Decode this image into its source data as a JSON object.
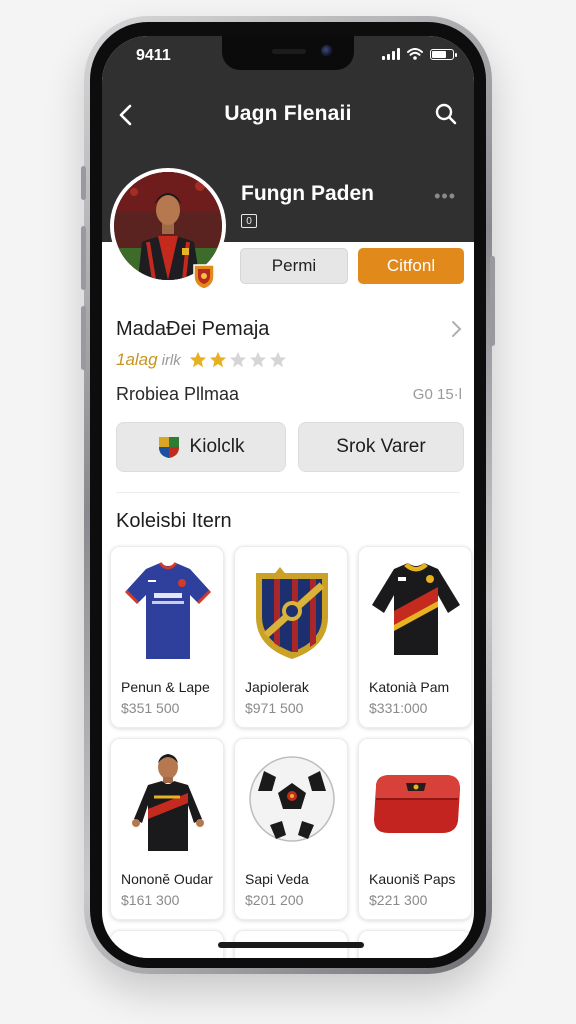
{
  "status_bar": {
    "time": "9411"
  },
  "nav": {
    "title": "Uagn Flenaii"
  },
  "profile": {
    "name": "Fungn Paden",
    "tag": "0",
    "btn_primary": "Permi",
    "btn_follow": "Citfonl",
    "accent": "#e2891c"
  },
  "details": {
    "title": "MadaĐei Pemaja",
    "rating_label": "1alag",
    "rating_sub": "irlk",
    "rating_value": 2,
    "rating_max": 5,
    "sub_label": "Rrobiea Pllmaa",
    "sub_value": "G0 15·l"
  },
  "actions": {
    "primary": "Kiolclk",
    "secondary": "Srok Varer"
  },
  "section": {
    "title": "Koleisbi Itern"
  },
  "items": [
    {
      "name": "Penun & Lape",
      "price": "$351 500",
      "icon": "blue-jersey"
    },
    {
      "name": "Japiolerak",
      "price": "$971 500",
      "icon": "club-crest"
    },
    {
      "name": "Katonià Pam",
      "price": "$331:000",
      "icon": "black-red-jersey"
    },
    {
      "name": "Nononĕ Oudar",
      "price": "$161 300",
      "icon": "player-figure"
    },
    {
      "name": "Sapi Veda",
      "price": "$201 200",
      "icon": "soccer-ball"
    },
    {
      "name": "Kauoniš Paps",
      "price": "$221 300",
      "icon": "red-case"
    }
  ]
}
